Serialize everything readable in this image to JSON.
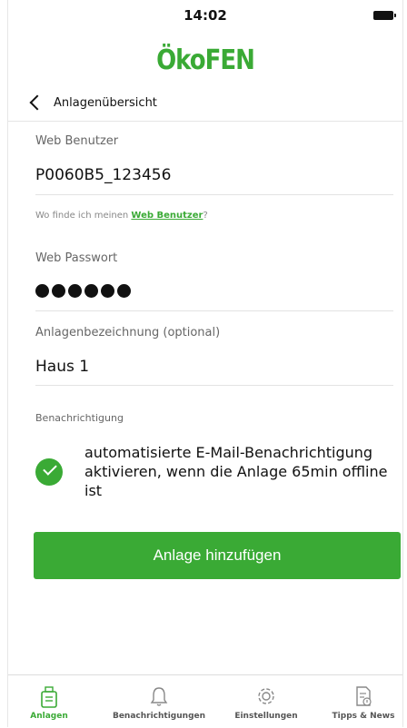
{
  "status_bar": {
    "time": "14:02"
  },
  "logo": {
    "text": "ÖkoFEN"
  },
  "nav": {
    "back_label": "Anlagenübersicht"
  },
  "form": {
    "web_user": {
      "label": "Web Benutzer",
      "value": "P0060B5_123456"
    },
    "hint": {
      "prefix": "Wo finde ich meinen ",
      "link": "Web Benutzer",
      "suffix": "?"
    },
    "web_password": {
      "label": "Web Passwort",
      "masked_length": 6
    },
    "system_name": {
      "label": "Anlagenbezeichnung (optional)",
      "value": "Haus 1"
    },
    "notification": {
      "section_title": "Benachrichtigung",
      "checked": true,
      "text": "automatisierte E-Mail-Benachrichtigung aktivieren, wenn die Anlage 65min offline ist"
    },
    "submit_label": "Anlage hinzufügen"
  },
  "tabbar": {
    "active": "Anlagen",
    "items": [
      {
        "label": "Anlagen",
        "icon": "system-icon"
      },
      {
        "label": "Benachrichtigungen",
        "icon": "bell-icon"
      },
      {
        "label": "Einstellungen",
        "icon": "gear-icon"
      },
      {
        "label": "Tipps & News",
        "icon": "news-icon"
      }
    ]
  },
  "colors": {
    "accent": "#3aaa35",
    "text": "#111111",
    "muted": "#666666"
  }
}
